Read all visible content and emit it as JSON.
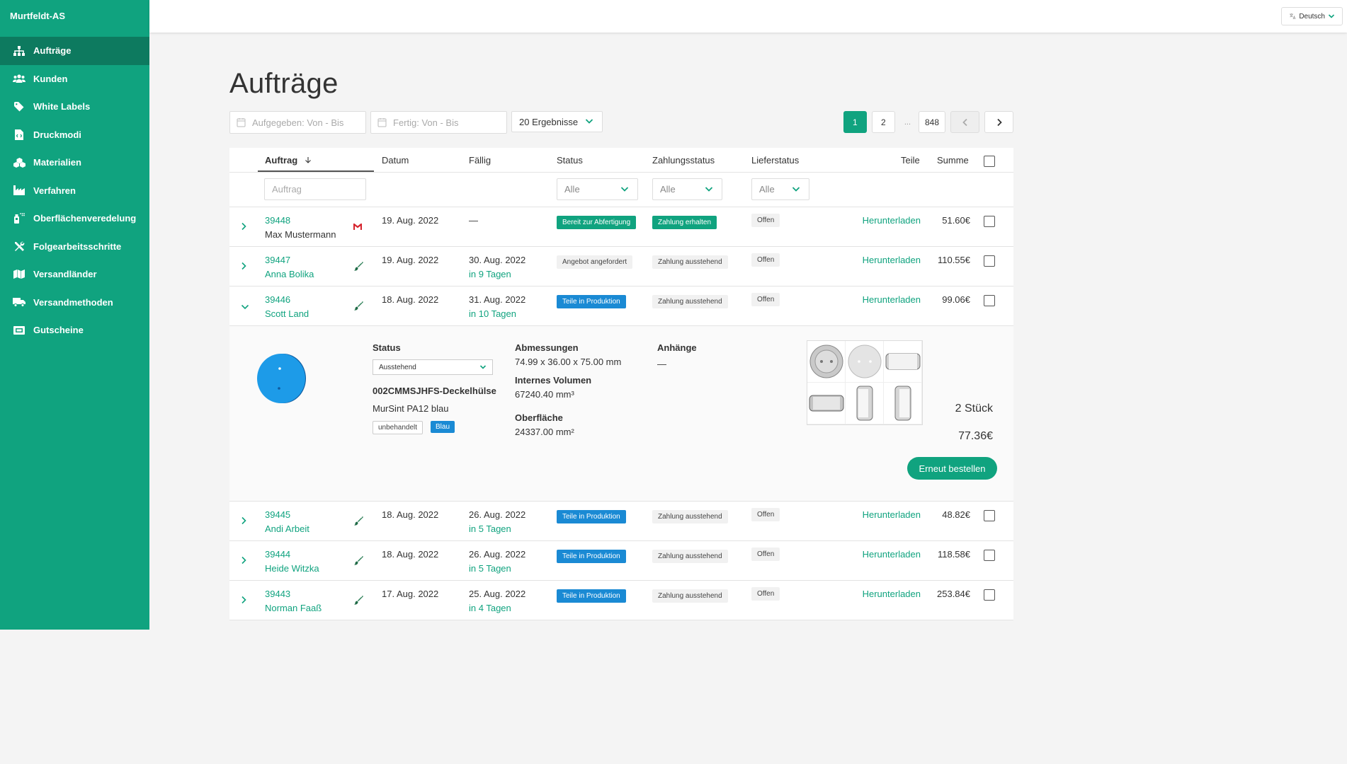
{
  "app": {
    "brand": "Murtfeldt-AS"
  },
  "sidebar": {
    "items": [
      {
        "label": "Aufträge",
        "icon": "sitemap-icon",
        "active": true
      },
      {
        "label": "Kunden",
        "icon": "users-icon"
      },
      {
        "label": "White Labels",
        "icon": "tag-icon"
      },
      {
        "label": "Druckmodi",
        "icon": "file-code-icon"
      },
      {
        "label": "Materialien",
        "icon": "cubes-icon"
      },
      {
        "label": "Verfahren",
        "icon": "industry-icon"
      },
      {
        "label": "Oberflächenveredelung",
        "icon": "spray-can-icon"
      },
      {
        "label": "Folgearbeitsschritte",
        "icon": "tools-icon"
      },
      {
        "label": "Versandländer",
        "icon": "map-icon"
      },
      {
        "label": "Versandmethoden",
        "icon": "truck-icon"
      },
      {
        "label": "Gutscheine",
        "icon": "ticket-icon"
      }
    ]
  },
  "topbar": {
    "language": "Deutsch"
  },
  "page": {
    "title": "Aufträge"
  },
  "filters": {
    "placed_placeholder": "Aufgegeben: Von - Bis",
    "finished_placeholder": "Fertig: Von - Bis",
    "results": "20 Ergebnisse"
  },
  "pagination": {
    "pages": [
      "1",
      "2"
    ],
    "ellipsis": "...",
    "last": "848",
    "current": "1"
  },
  "table": {
    "headers": {
      "order": "Auftrag",
      "date": "Datum",
      "due": "Fällig",
      "status": "Status",
      "payment": "Zahlungsstatus",
      "delivery": "Lieferstatus",
      "parts": "Teile",
      "sum": "Summe"
    },
    "filter_row": {
      "order_placeholder": "Auftrag",
      "status": "Alle",
      "payment": "Alle",
      "delivery": "Alle"
    },
    "rows": [
      {
        "id": "39448",
        "customer": "Max Mustermann",
        "customer_plain": true,
        "label_icon": "m-logo-icon",
        "date": "19. Aug. 2022",
        "due": "—",
        "due_rel": "",
        "status": "Bereit zur Abfertigung",
        "status_color": "green",
        "payment": "Zahlung erhalten",
        "payment_color": "green",
        "delivery": "Offen",
        "parts": "Herunterladen",
        "sum": "51.60€",
        "expanded": false
      },
      {
        "id": "39447",
        "customer": "Anna Bolika",
        "label_icon": "brush-icon",
        "date": "19. Aug. 2022",
        "due": "30. Aug. 2022",
        "due_rel": "in 9 Tagen",
        "status": "Angebot angefordert",
        "status_color": "grey",
        "payment": "Zahlung ausstehend",
        "payment_color": "grey",
        "delivery": "Offen",
        "parts": "Herunterladen",
        "sum": "110.55€",
        "expanded": false
      },
      {
        "id": "39446",
        "customer": "Scott Land",
        "label_icon": "brush-icon",
        "date": "18. Aug. 2022",
        "due": "31. Aug. 2022",
        "due_rel": "in 10 Tagen",
        "status": "Teile in Produktion",
        "status_color": "blue",
        "payment": "Zahlung ausstehend",
        "payment_color": "grey",
        "delivery": "Offen",
        "parts": "Herunterladen",
        "sum": "99.06€",
        "expanded": true
      },
      {
        "id": "39445",
        "customer": "Andi Arbeit",
        "label_icon": "brush-icon",
        "date": "18. Aug. 2022",
        "due": "26. Aug. 2022",
        "due_rel": "in 5 Tagen",
        "status": "Teile in Produktion",
        "status_color": "blue",
        "payment": "Zahlung ausstehend",
        "payment_color": "grey",
        "delivery": "Offen",
        "parts": "Herunterladen",
        "sum": "48.82€",
        "expanded": false
      },
      {
        "id": "39444",
        "customer": "Heide Witzka",
        "label_icon": "brush-icon",
        "date": "18. Aug. 2022",
        "due": "26. Aug. 2022",
        "due_rel": "in 5 Tagen",
        "status": "Teile in Produktion",
        "status_color": "blue",
        "payment": "Zahlung ausstehend",
        "payment_color": "grey",
        "delivery": "Offen",
        "parts": "Herunterladen",
        "sum": "118.58€",
        "expanded": false
      },
      {
        "id": "39443",
        "customer": "Norman Faaß",
        "label_icon": "brush-icon",
        "date": "17. Aug. 2022",
        "due": "25. Aug. 2022",
        "due_rel": "in 4 Tagen",
        "status": "Teile in Produktion",
        "status_color": "blue",
        "payment": "Zahlung ausstehend",
        "payment_color": "grey",
        "delivery": "Offen",
        "parts": "Herunterladen",
        "sum": "253.84€",
        "expanded": false
      }
    ]
  },
  "detail": {
    "status_label": "Status",
    "status_value": "Ausstehend",
    "part_name": "002CMMSJHFS-Deckelhülse",
    "material": "MurSint PA12 blau",
    "tags": [
      "unbehandelt",
      "Blau"
    ],
    "dimensions_label": "Abmessungen",
    "dimensions": "74.99 x 36.00 x 75.00 mm",
    "volume_label": "Internes Volumen",
    "volume": "67240.40 mm³",
    "surface_label": "Oberfläche",
    "surface": "24337.00 mm²",
    "attachments_label": "Anhänge",
    "attachments": "—",
    "quantity": "2 Stück",
    "price": "77.36€",
    "reorder": "Erneut bestellen"
  },
  "colors": {
    "brand": "#10a37f",
    "brand_dark": "#0d7a5f",
    "blue": "#1a8ad4"
  }
}
